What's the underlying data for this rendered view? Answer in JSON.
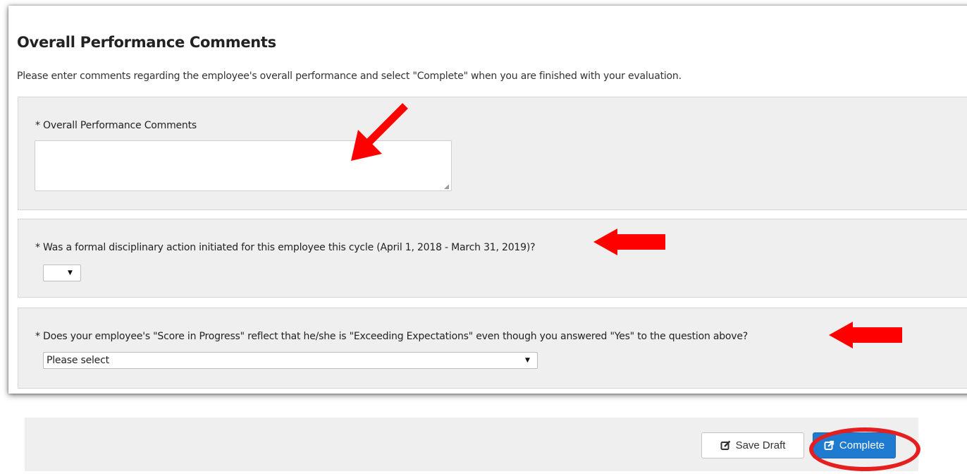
{
  "section": {
    "title": "Overall Performance Comments",
    "instructions": "Please enter comments regarding the employee's overall performance and select \"Complete\" when you are finished with your evaluation."
  },
  "questions": [
    {
      "label": "* Overall Performance Comments",
      "type": "textarea",
      "value": ""
    },
    {
      "label": "* Was a formal disciplinary action initiated for this employee this cycle (April 1, 2018 - March 31, 2019)?",
      "type": "select",
      "selected": ""
    },
    {
      "label": "* Does your employee's \"Score in Progress\" reflect that he/she is \"Exceeding Expectations\" even though you answered \"Yes\" to the question above?",
      "type": "select",
      "selected": "Please select"
    }
  ],
  "icons": {
    "dropdown_caret": "▼",
    "resize_grip": "◢"
  },
  "footer": {
    "save_draft_label": "Save Draft",
    "save_draft_icon": "edit-icon",
    "complete_label": "Complete",
    "complete_icon": "external-link-icon"
  },
  "annotations": {
    "arrow_color": "#ff0000",
    "highlight_ring_color": "#e51f1f"
  },
  "colors": {
    "panel_background": "#efefef",
    "primary_button": "#1f7bd0",
    "card_border_shadow": "#000000"
  }
}
